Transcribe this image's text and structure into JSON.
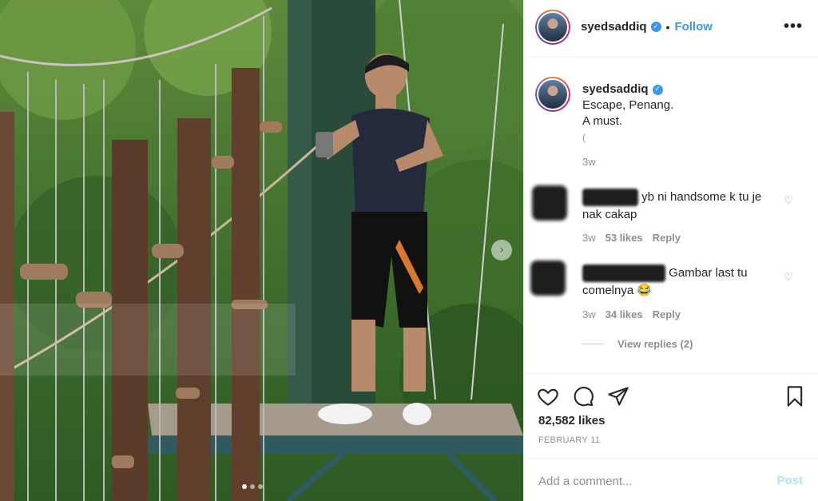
{
  "post": {
    "username": "syedsaddiq",
    "separator": "•",
    "follow_label": "Follow",
    "more_icon": "more-horizontal-icon"
  },
  "caption": {
    "username": "syedsaddiq",
    "lines": [
      "Escape, Penang.",
      "A must.",
      "("
    ],
    "time": "3w"
  },
  "comments": [
    {
      "text": "yb ni handsome k tu je nak cakap",
      "time": "3w",
      "likes": "53 likes",
      "reply_label": "Reply"
    },
    {
      "text": "Gambar last tu comelnya 😂",
      "time": "3w",
      "likes": "34 likes",
      "reply_label": "Reply"
    }
  ],
  "view_replies": "View replies (2)",
  "actions": {
    "likes": "82,582 likes",
    "date": "FEBRUARY 11"
  },
  "comment_box": {
    "placeholder": "Add a comment...",
    "post_label": "Post"
  },
  "carousel": {
    "next_icon": "chevron-right-icon",
    "dots": 3,
    "active_dot": 1
  },
  "colors": {
    "accent": "#3897f0",
    "post_disabled": "#b2dffc",
    "muted": "#8e8e8e"
  }
}
